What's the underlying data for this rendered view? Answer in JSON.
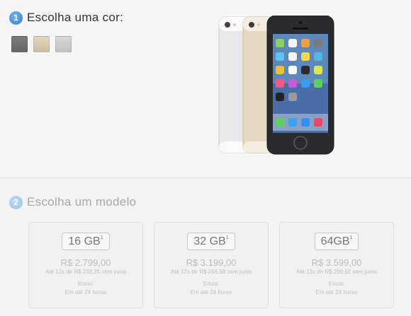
{
  "color_step": {
    "number": "1",
    "title": "Escolha uma cor:",
    "swatches": [
      {
        "name": "space-gray",
        "color": "#737373"
      },
      {
        "name": "gold",
        "color": "#d8ccb4"
      },
      {
        "name": "silver",
        "color": "#cccccc"
      }
    ]
  },
  "model_step": {
    "number": "2",
    "title": "Escolha um modelo",
    "models": [
      {
        "capacity": "16 GB",
        "footnote": "1",
        "price": "R$ 2.799,00",
        "installments": "Até 12x de R$ 233,25 sem juros",
        "shipping_label": "Envio:",
        "shipping_time": "Em até 24 horas"
      },
      {
        "capacity": "32 GB",
        "footnote": "1",
        "price": "R$ 3.199,00",
        "installments": "Até 12x de R$ 266,58 sem juros",
        "shipping_label": "Envio:",
        "shipping_time": "Em até 24 horas"
      },
      {
        "capacity": "64GB",
        "footnote": "1",
        "price": "R$ 3.599,00",
        "installments": "Até 12x de R$ 299,92 sem juros",
        "shipping_label": "Envio:",
        "shipping_time": "Em até 24 horas"
      }
    ]
  },
  "colors": {
    "accent": "#2f7fd3",
    "phone_dark": "#2b2b2d",
    "phone_gold": "#e3d6bd",
    "phone_silver": "#e6e6e6"
  }
}
